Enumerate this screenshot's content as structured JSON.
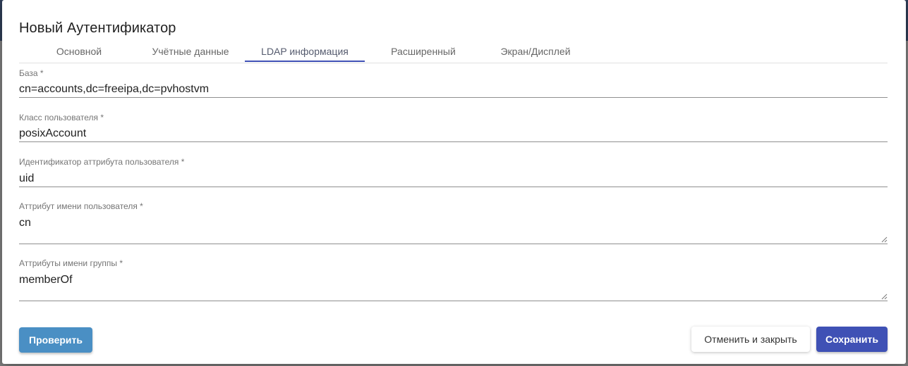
{
  "dialog": {
    "title": "Новый Аутентификатор"
  },
  "tabs": [
    {
      "label": "Основной",
      "active": false
    },
    {
      "label": "Учётные данные",
      "active": false
    },
    {
      "label": "LDAP информация",
      "active": true
    },
    {
      "label": "Расширенный",
      "active": false
    },
    {
      "label": "Экран/Дисплей",
      "active": false
    }
  ],
  "fields": [
    {
      "label": "База *",
      "value": "cn=accounts,dc=freeipa,dc=pvhostvm",
      "type": "input"
    },
    {
      "label": "Класс пользователя *",
      "value": "posixAccount",
      "type": "input"
    },
    {
      "label": "Идентификатор аттрибута пользователя *",
      "value": "uid",
      "type": "input"
    },
    {
      "label": "Аттрибут имени пользователя *",
      "value": "cn",
      "type": "textarea"
    },
    {
      "label": "Аттрибуты имени группы *",
      "value": "memberOf",
      "type": "textarea"
    }
  ],
  "buttons": {
    "test": "Проверить",
    "cancel": "Отменить и закрыть",
    "save": "Сохранить"
  },
  "colors": {
    "accent": "#3f51b5",
    "test_button": "#4a8fc4"
  },
  "icons": {
    "textarea_resize": "resize-grip-icon"
  }
}
